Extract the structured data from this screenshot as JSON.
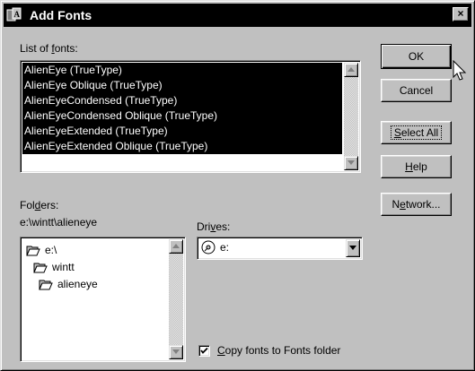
{
  "window": {
    "title": "Add Fonts",
    "close_glyph": "×"
  },
  "font_list": {
    "label_pre": "List of ",
    "label_key": "f",
    "label_post": "onts:",
    "items": [
      "AlienEye (TrueType)",
      "AlienEye Oblique (TrueType)",
      "AlienEyeCondensed (TrueType)",
      "AlienEyeCondensed Oblique (TrueType)",
      "AlienEyeExtended (TrueType)",
      "AlienEyeExtended Oblique (TrueType)"
    ]
  },
  "folders": {
    "label_pre": "Fol",
    "label_key": "d",
    "label_post": "ers:",
    "current_path": "e:\\wintt\\alieneye",
    "items": [
      {
        "name": "e:\\",
        "icon": "open-folder-icon"
      },
      {
        "name": "wintt",
        "icon": "open-folder-icon"
      },
      {
        "name": "alieneye",
        "icon": "open-folder-icon"
      }
    ]
  },
  "drives": {
    "label_pre": "Dri",
    "label_key": "v",
    "label_post": "es:",
    "selected": "e:",
    "icon": "cd-drive-icon"
  },
  "buttons": {
    "ok": "OK",
    "cancel": "Cancel",
    "select_all_key": "S",
    "select_all_rest": "elect All",
    "help_key": "H",
    "help_rest": "elp",
    "network_pre": "N",
    "network_key": "e",
    "network_post": "twork..."
  },
  "copy_option": {
    "key": "C",
    "rest": "opy fonts to Fonts folder",
    "checked": true
  },
  "colors": {
    "face": "#c0c0c0",
    "title_bar": "#000000",
    "selection": "#000000"
  }
}
